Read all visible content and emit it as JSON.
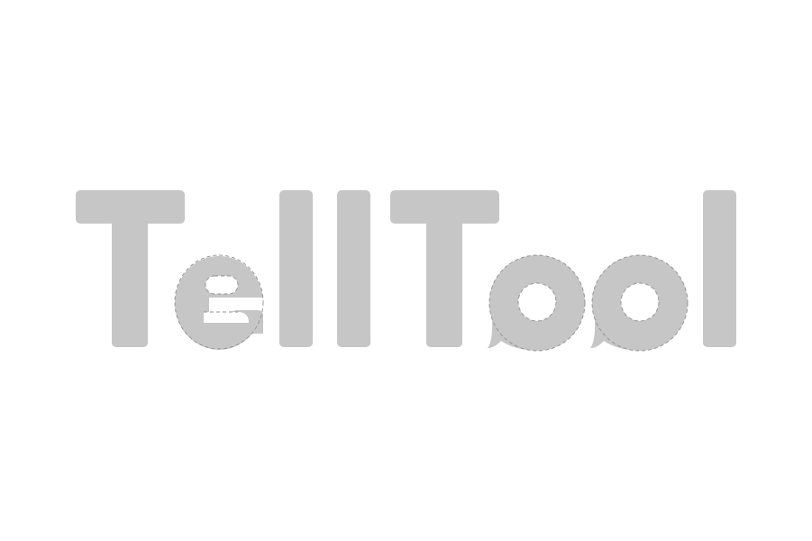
{
  "logo": {
    "wordmark": "TellTool",
    "fill_color": "#c6c6c6",
    "guide_color": "#8f8f8f",
    "background_color": "#ffffff"
  }
}
